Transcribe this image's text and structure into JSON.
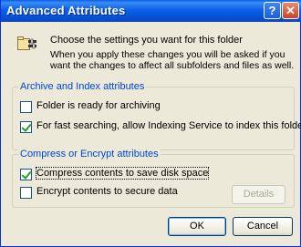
{
  "window": {
    "title": "Advanced Attributes",
    "help_button": "?",
    "close_button": "✕"
  },
  "intro": {
    "heading": "Choose the settings you want for this folder",
    "description": "When you apply these changes you will be asked if you want the changes to affect all subfolders and files as well."
  },
  "archive_group": {
    "title": "Archive and Index attributes",
    "options": [
      {
        "label": "Folder is ready for archiving",
        "checked": false
      },
      {
        "label": "For fast searching, allow Indexing Service to index this folder",
        "checked": true
      }
    ]
  },
  "compress_group": {
    "title": "Compress or Encrypt attributes",
    "options": [
      {
        "label": "Compress contents to save disk space",
        "checked": true
      },
      {
        "label": "Encrypt contents to secure data",
        "checked": false
      }
    ],
    "details_button": "Details"
  },
  "footer": {
    "ok_button": "OK",
    "cancel_button": "Cancel"
  }
}
